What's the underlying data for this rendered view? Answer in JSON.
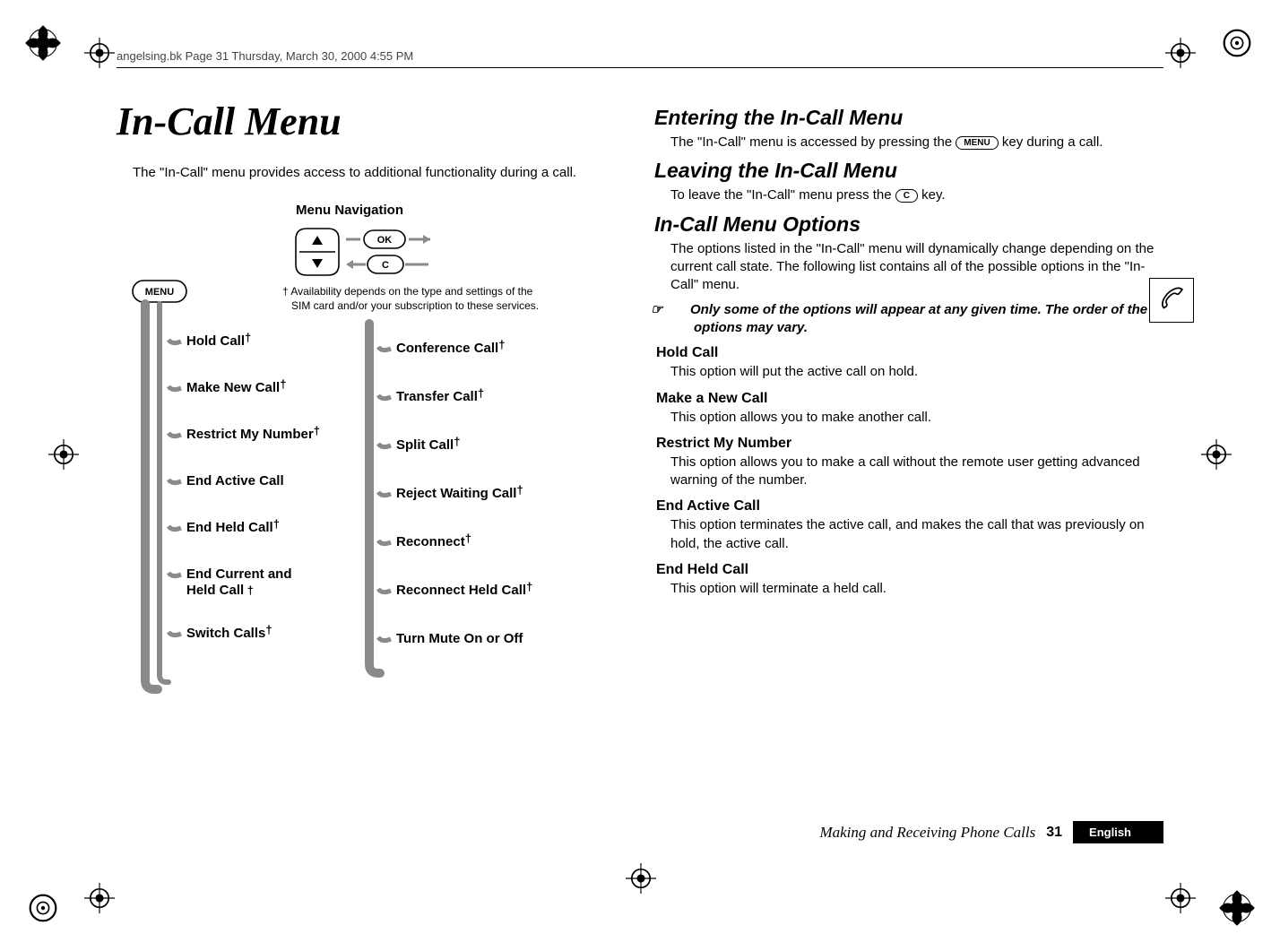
{
  "running_header": "angelsing.bk  Page 31  Thursday, March 30, 2000  4:55 PM",
  "section_title": "In-Call Menu",
  "intro": "The \"In-Call\" menu provides access to additional functionality during a call.",
  "diagram": {
    "nav_title": "Menu Navigation",
    "menu_button": "MENU",
    "ok_button": "OK",
    "c_button": "C",
    "footnote_dagger": "† Availability depends on the type and settings of the SIM card and/or your subscription to these services.",
    "left_items": [
      {
        "label": "Hold Call",
        "dagger": true
      },
      {
        "label": "Make New Call",
        "dagger": true
      },
      {
        "label": "Restrict My Number",
        "dagger": true
      },
      {
        "label": "End Active Call",
        "dagger": false
      },
      {
        "label": "End Held Call",
        "dagger": true
      },
      {
        "label": "End Current and Held Call",
        "dagger": true,
        "twoLine": true
      },
      {
        "label": "Switch Calls",
        "dagger": true
      }
    ],
    "right_items": [
      {
        "label": "Conference Call",
        "dagger": true
      },
      {
        "label": "Transfer Call",
        "dagger": true
      },
      {
        "label": "Split Call",
        "dagger": true
      },
      {
        "label": "Reject Waiting Call",
        "dagger": true
      },
      {
        "label": "Reconnect",
        "dagger": true
      },
      {
        "label": "Reconnect Held Call",
        "dagger": true
      },
      {
        "label": "Turn Mute On or Off",
        "dagger": false
      }
    ]
  },
  "right": {
    "h_enter": "Entering the In-Call Menu",
    "enter_body_pre": "The \"In-Call\" menu is accessed by pressing the ",
    "enter_body_key": "MENU",
    "enter_body_post": " key during a call.",
    "h_leave": "Leaving the In-Call Menu",
    "leave_body_pre": "To leave the \"In-Call\" menu press the ",
    "leave_body_key": "C",
    "leave_body_post": " key.",
    "h_options": "In-Call Menu Options",
    "options_body": "The options listed in the \"In-Call\" menu will dynamically change depending on the current call state. The following list contains all of the possible options in the \"In-Call\" menu.",
    "note_icon": "☞",
    "note": "Only some of the options will appear at any given time. The order of the options may vary.",
    "items": [
      {
        "title": "Hold Call",
        "body": "This option will put the active call on hold."
      },
      {
        "title": "Make a New Call",
        "body": "This option allows you to make another call."
      },
      {
        "title": "Restrict My Number",
        "body": "This option allows you to make a call without the remote user getting advanced warning of the number."
      },
      {
        "title": "End Active Call",
        "body": "This option terminates the active call, and makes the call that was previously on hold, the active call."
      },
      {
        "title": "End Held Call",
        "body": "This option will terminate a held call."
      }
    ]
  },
  "footer": {
    "chapter": "Making and Receiving Phone Calls",
    "page": "31",
    "language": "English"
  }
}
